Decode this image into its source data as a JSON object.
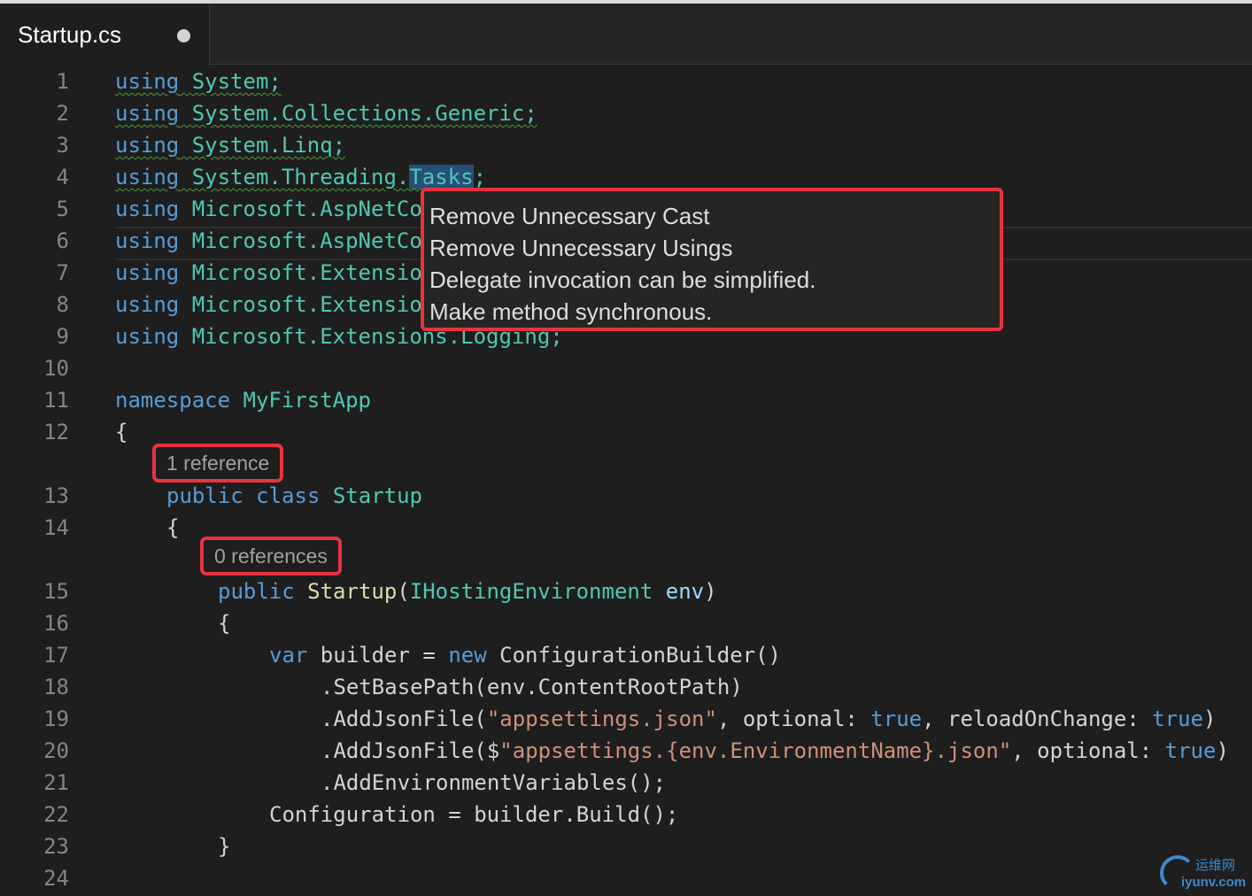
{
  "tab": {
    "title": "Startup.cs",
    "dirty_indicator": "●"
  },
  "lines": [
    {
      "n": "1"
    },
    {
      "n": "2"
    },
    {
      "n": "3"
    },
    {
      "n": "4"
    },
    {
      "n": "5"
    },
    {
      "n": "6"
    },
    {
      "n": "7"
    },
    {
      "n": "8"
    },
    {
      "n": "9"
    },
    {
      "n": "10"
    },
    {
      "n": "11"
    },
    {
      "n": "12"
    },
    {
      "n": "13"
    },
    {
      "n": "14"
    },
    {
      "n": "15"
    },
    {
      "n": "16"
    },
    {
      "n": "17"
    },
    {
      "n": "18"
    },
    {
      "n": "19"
    },
    {
      "n": "20"
    },
    {
      "n": "21"
    },
    {
      "n": "22"
    },
    {
      "n": "23"
    },
    {
      "n": "24"
    }
  ],
  "code": {
    "using": "using",
    "system": "System;",
    "collections": "System.Collections.Generic;",
    "linq": "System.Linq;",
    "threading": "System.Threading.",
    "tasks": "Tasks",
    "semi": ";",
    "aspnet5": "Microsoft.AspNetCo",
    "aspnet6": "Microsoft.AspNetCo",
    "ext7": "Microsoft.Extensio",
    "ext8": "Microsoft.Extensio",
    "logging": "Microsoft.Extensions.Logging;",
    "namespace_kw": "namespace",
    "namespace_name": "MyFirstApp",
    "open_brace": "{",
    "close_brace": "}",
    "public_kw": "public",
    "class_kw": "class",
    "class_name": "Startup",
    "ctor_name": "Startup",
    "paren_open": "(",
    "param_type": "IHostingEnvironment",
    "param_name": "env",
    "paren_close": ")",
    "var_kw": "var",
    "builder_assign": " builder = ",
    "new_kw": "new",
    "config_builder": " ConfigurationBuilder()",
    "set_base_path": ".SetBasePath(env.ContentRootPath)",
    "add_json_open": ".AddJsonFile(",
    "appsettings_str": "\"appsettings.json\"",
    "optional_label": ", optional: ",
    "true_kw": "true",
    "reload_label": ", reloadOnChange: ",
    "close_paren": ")",
    "add_json_open2": ".AddJsonFile($",
    "env_str": "\"appsettings.{env.EnvironmentName}.json\"",
    "add_env_vars": ".AddEnvironmentVariables();",
    "configuration_assign": "Configuration = builder.Build();"
  },
  "codelens": {
    "class_refs": "1 reference",
    "ctor_refs": "0 references"
  },
  "quickfix": {
    "items": [
      "Remove Unnecessary Cast",
      "Remove Unnecessary Usings",
      "Delegate invocation can be simplified.",
      "Make method synchronous."
    ]
  },
  "watermark": {
    "cn": "运维网",
    "en": "iyunv.com"
  },
  "colors": {
    "keyword": "#569cd6",
    "type": "#4ec9b0",
    "string": "#ce9178",
    "function": "#dcdcaa",
    "parameter": "#9cdcfe",
    "highlight_box": "#e8333f",
    "squiggle": "#4b9b39"
  }
}
